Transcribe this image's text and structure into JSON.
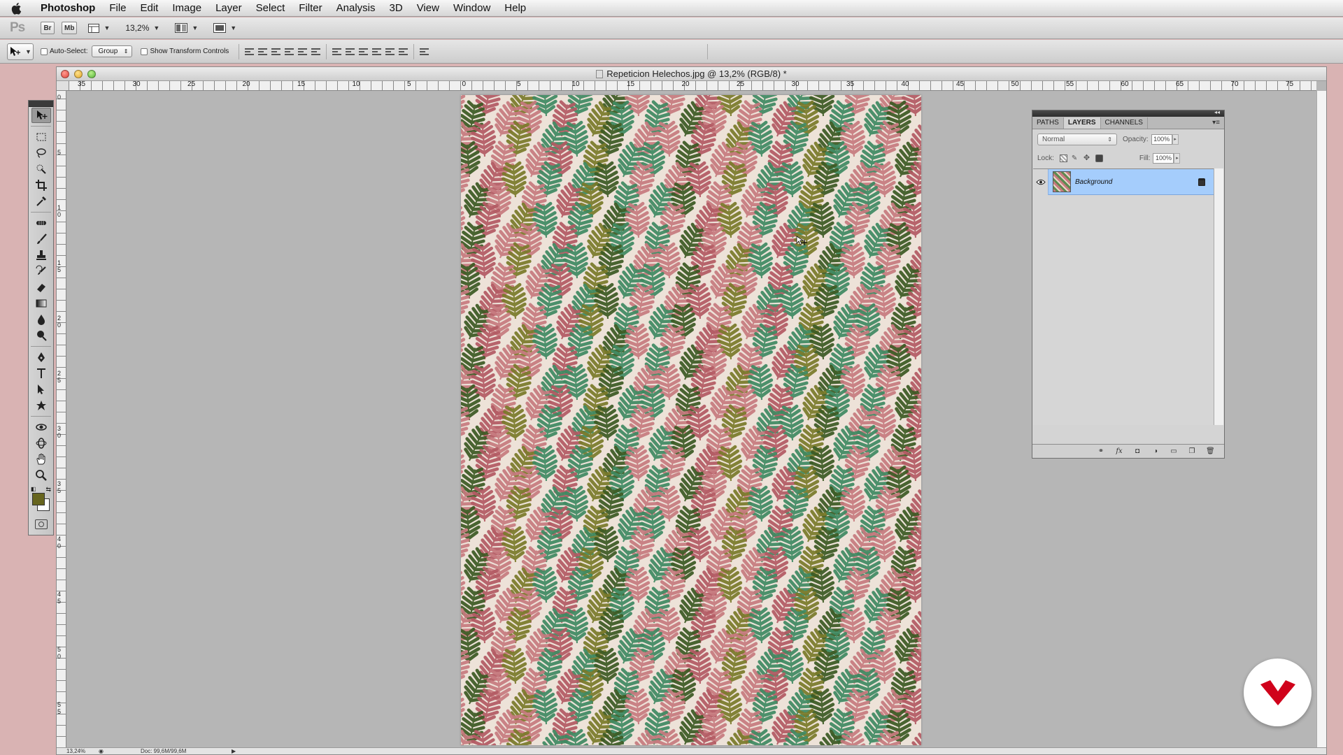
{
  "menubar": {
    "app": "Photoshop",
    "items": [
      "File",
      "Edit",
      "Image",
      "Layer",
      "Select",
      "Filter",
      "Analysis",
      "3D",
      "View",
      "Window",
      "Help"
    ]
  },
  "appbar": {
    "logo": "Ps",
    "bridge": "Br",
    "minibridge": "Mb",
    "zoom": "13,2%"
  },
  "options": {
    "auto_select_label": "Auto-Select:",
    "auto_select_target": "Group",
    "show_transform_label": "Show Transform Controls"
  },
  "document": {
    "title": "Repeticion Helechos.jpg @ 13,2% (RGB/8) *",
    "h_ruler": [
      "35",
      "30",
      "25",
      "20",
      "15",
      "10",
      "5",
      "0",
      "5",
      "10",
      "15",
      "20",
      "25",
      "30",
      "35",
      "40",
      "45",
      "50",
      "55",
      "60",
      "65",
      "70",
      "75"
    ],
    "v_ruler": [
      "0",
      "5",
      "1 0",
      "1 5",
      "2 0",
      "2 5",
      "3 0",
      "3 5",
      "4 0",
      "4 5",
      "5 0",
      "5 5"
    ],
    "status_zoom": "13,24%",
    "status_doc": "Doc: 99,6M/99,6M"
  },
  "tools": {
    "foreground": "#67651e",
    "background": "#ffffff"
  },
  "layers_panel": {
    "tabs": [
      "PATHS",
      "LAYERS",
      "CHANNELS"
    ],
    "active_tab": "LAYERS",
    "blend_mode": "Normal",
    "opacity_label": "Opacity:",
    "opacity": "100%",
    "lock_label": "Lock:",
    "fill_label": "Fill:",
    "fill": "100%",
    "layers": [
      {
        "name": "Background"
      }
    ]
  },
  "colors": {
    "selection": "#a5cdfc",
    "fern_pink": "#c77a7f",
    "fern_rose": "#b35a63",
    "fern_green": "#3f8a62",
    "fern_dark": "#3c5a23",
    "fern_olive": "#7a7a2a",
    "paper": "#ede2d8",
    "badge_red": "#d0021b"
  }
}
